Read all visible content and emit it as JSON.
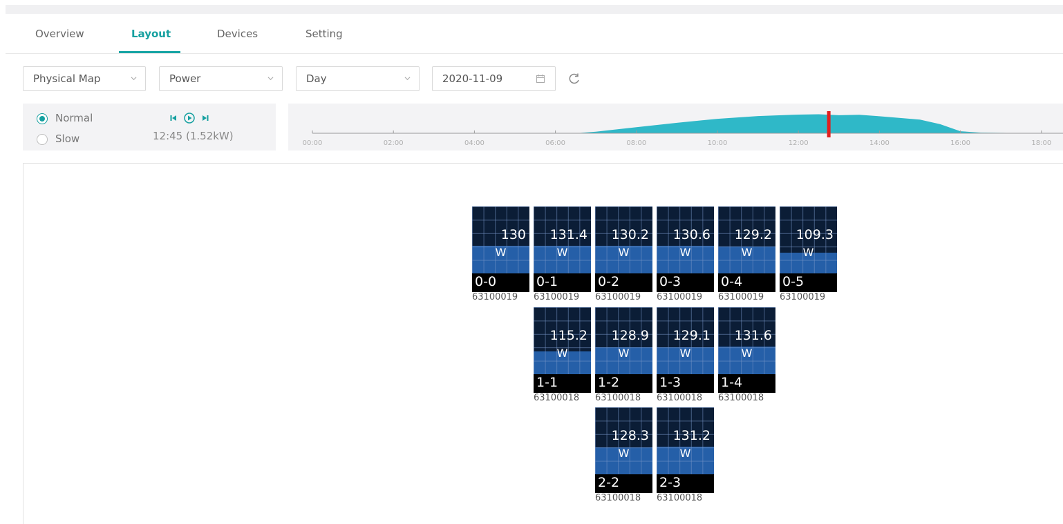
{
  "tabs": [
    {
      "label": "Overview",
      "active": false
    },
    {
      "label": "Layout",
      "active": true
    },
    {
      "label": "Devices",
      "active": false
    },
    {
      "label": "Setting",
      "active": false
    }
  ],
  "filters": {
    "view": "Physical Map",
    "metric": "Power",
    "period": "Day",
    "date": "2020-11-09"
  },
  "playback": {
    "speed_options": [
      {
        "label": "Normal",
        "selected": true
      },
      {
        "label": "Slow",
        "selected": false
      }
    ],
    "current": "12:45 (1.52kW)"
  },
  "timeline": {
    "ticks": [
      "00:00",
      "02:00",
      "04:00",
      "06:00",
      "08:00",
      "10:00",
      "12:00",
      "14:00",
      "16:00",
      "18:00"
    ],
    "marker_time": "12:45",
    "curve": [
      [
        0,
        0
      ],
      [
        6.5,
        0
      ],
      [
        7,
        0.08
      ],
      [
        8,
        0.3
      ],
      [
        9,
        0.52
      ],
      [
        10,
        0.72
      ],
      [
        11,
        0.86
      ],
      [
        12,
        0.93
      ],
      [
        12.5,
        0.95
      ],
      [
        13,
        0.9
      ],
      [
        13.5,
        0.92
      ],
      [
        14,
        0.85
      ],
      [
        15,
        0.68
      ],
      [
        15.5,
        0.45
      ],
      [
        16,
        0.1
      ],
      [
        16.5,
        0.03
      ],
      [
        18,
        0
      ],
      [
        18.5,
        0
      ]
    ],
    "colors": {
      "fill": "#2fb8c8",
      "marker": "#e02020",
      "axis": "#9a9a9a"
    }
  },
  "panels": [
    {
      "id": "0-0",
      "power": "130",
      "unit": "W",
      "sn": "63100019",
      "level": 0.41
    },
    {
      "id": "0-1",
      "power": "131.4",
      "unit": "W",
      "sn": "63100019",
      "level": 0.41
    },
    {
      "id": "0-2",
      "power": "130.2",
      "unit": "W",
      "sn": "63100019",
      "level": 0.41
    },
    {
      "id": "0-3",
      "power": "130.6",
      "unit": "W",
      "sn": "63100019",
      "level": 0.41
    },
    {
      "id": "0-4",
      "power": "129.2",
      "unit": "W",
      "sn": "63100019",
      "level": 0.4
    },
    {
      "id": "0-5",
      "power": "109.3",
      "unit": "W",
      "sn": "63100019",
      "level": 0.31
    },
    {
      "id": "1-1",
      "power": "115.2",
      "unit": "W",
      "sn": "63100018",
      "level": 0.34
    },
    {
      "id": "1-2",
      "power": "128.9",
      "unit": "W",
      "sn": "63100018",
      "level": 0.4
    },
    {
      "id": "1-3",
      "power": "129.1",
      "unit": "W",
      "sn": "63100018",
      "level": 0.4
    },
    {
      "id": "1-4",
      "power": "131.6",
      "unit": "W",
      "sn": "63100018",
      "level": 0.41
    },
    {
      "id": "2-2",
      "power": "128.3",
      "unit": "W",
      "sn": "63100018",
      "level": 0.4
    },
    {
      "id": "2-3",
      "power": "131.2",
      "unit": "W",
      "sn": "63100018",
      "level": 0.41
    }
  ]
}
